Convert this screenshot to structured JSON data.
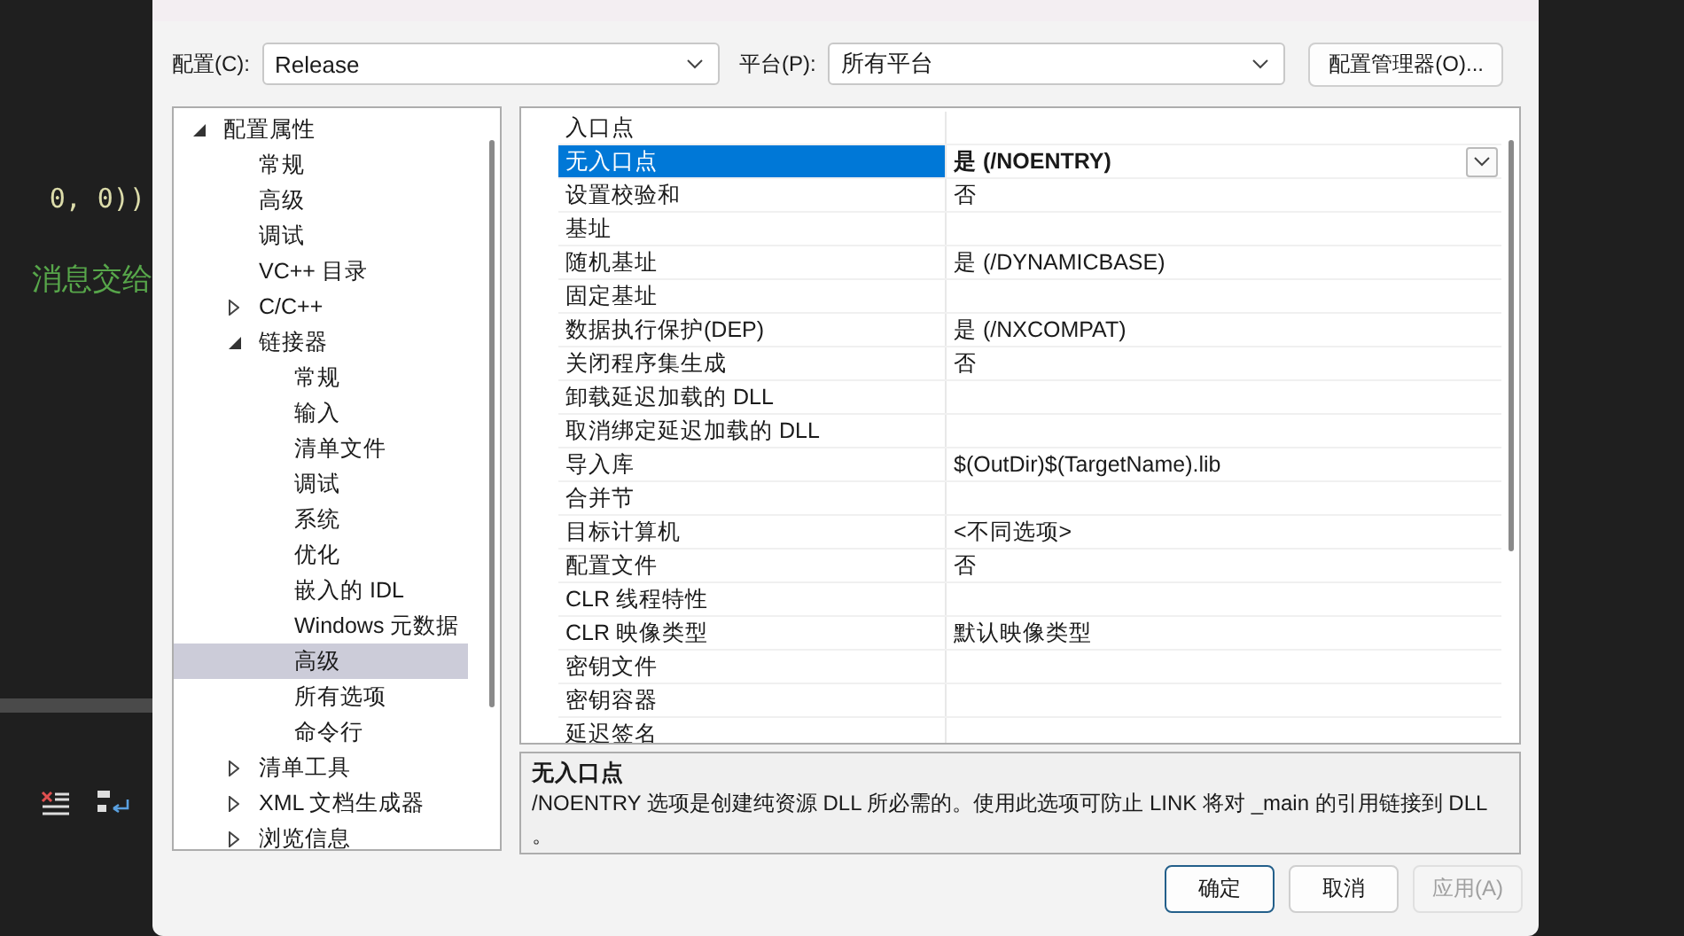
{
  "editor": {
    "code_lines": [
      {
        "kind": "code",
        "text": "0, 0))"
      },
      {
        "kind": "comment",
        "text": "消息交给"
      }
    ]
  },
  "dialog": {
    "config_label": "配置(C):",
    "config_value": "Release",
    "platform_label": "平台(P):",
    "platform_value": "所有平台",
    "config_manager_button": "配置管理器(O)...",
    "tree": [
      {
        "label": "配置属性",
        "expanded": true,
        "selected": false,
        "children": [
          {
            "label": "常规",
            "selected": false
          },
          {
            "label": "高级",
            "selected": false
          },
          {
            "label": "调试",
            "selected": false
          },
          {
            "label": "VC++ 目录",
            "selected": false
          },
          {
            "label": "C/C++",
            "expanded": false,
            "selected": false
          },
          {
            "label": "链接器",
            "expanded": true,
            "selected": false,
            "children": [
              {
                "label": "常规",
                "selected": false
              },
              {
                "label": "输入",
                "selected": false
              },
              {
                "label": "清单文件",
                "selected": false
              },
              {
                "label": "调试",
                "selected": false
              },
              {
                "label": "系统",
                "selected": false
              },
              {
                "label": "优化",
                "selected": false
              },
              {
                "label": "嵌入的 IDL",
                "selected": false
              },
              {
                "label": "Windows 元数据",
                "selected": false
              },
              {
                "label": "高级",
                "selected": true
              },
              {
                "label": "所有选项",
                "selected": false
              },
              {
                "label": "命令行",
                "selected": false
              }
            ]
          },
          {
            "label": "清单工具",
            "expanded": false,
            "selected": false
          },
          {
            "label": "XML 文档生成器",
            "expanded": false,
            "selected": false
          },
          {
            "label": "浏览信息",
            "expanded": false,
            "selected": false
          }
        ]
      }
    ],
    "properties": [
      {
        "name": "入口点",
        "selected": false
      },
      {
        "name": "无入口点",
        "value": "是 (/NOENTRY)",
        "selected": true,
        "modified": true
      },
      {
        "name": "设置校验和",
        "value": "否",
        "selected": false,
        "modified": false
      },
      {
        "name": "基址",
        "selected": false
      },
      {
        "name": "随机基址",
        "value": "是 (/DYNAMICBASE)",
        "selected": false,
        "modified": false
      },
      {
        "name": "固定基址",
        "selected": false
      },
      {
        "name": "数据执行保护(DEP)",
        "value": "是 (/NXCOMPAT)",
        "selected": false,
        "modified": false
      },
      {
        "name": "关闭程序集生成",
        "value": "否",
        "selected": false,
        "modified": false
      },
      {
        "name": "卸载延迟加载的 DLL",
        "selected": false
      },
      {
        "name": "取消绑定延迟加载的 DLL",
        "selected": false
      },
      {
        "name": "导入库",
        "value": "$(OutDir)$(TargetName).lib",
        "selected": false,
        "modified": false
      },
      {
        "name": "合并节",
        "selected": false
      },
      {
        "name": "目标计算机",
        "value": "<不同选项>",
        "selected": false,
        "modified": false
      },
      {
        "name": "配置文件",
        "value": "否",
        "selected": false,
        "modified": false
      },
      {
        "name": "CLR 线程特性",
        "selected": false
      },
      {
        "name": "CLR 映像类型",
        "value": "默认映像类型",
        "selected": false,
        "modified": false
      },
      {
        "name": "密钥文件",
        "selected": false
      },
      {
        "name": "密钥容器",
        "selected": false
      },
      {
        "name": "延迟签名",
        "selected": false
      }
    ],
    "description": {
      "title": "无入口点",
      "text": "/NOENTRY 选项是创建纯资源 DLL 所必需的。使用此选项可防止 LINK 将对 _main 的引用链接到 DLL 。"
    },
    "buttons": [
      {
        "label": "确定",
        "kind": "default",
        "disabled": false
      },
      {
        "label": "取消",
        "kind": "normal",
        "disabled": false
      },
      {
        "label": "应用(A)",
        "kind": "normal",
        "disabled": true
      }
    ]
  }
}
